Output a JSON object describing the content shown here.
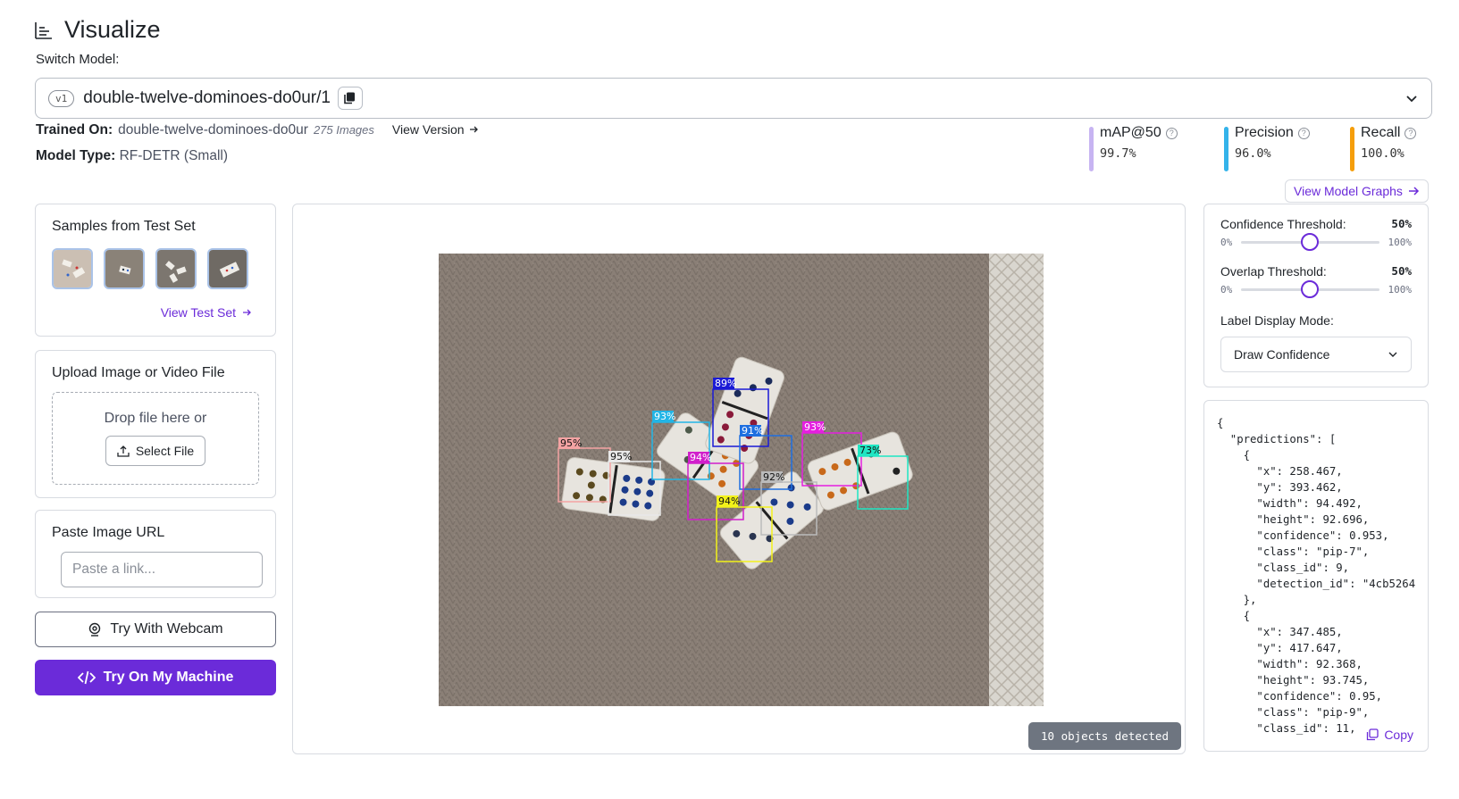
{
  "header": {
    "title": "Visualize",
    "switch_label": "Switch Model:"
  },
  "model": {
    "version": "v1",
    "name": "double-twelve-dominoes-do0ur/1"
  },
  "trained_on": {
    "label": "Trained On:",
    "value": "double-twelve-dominoes-do0ur",
    "images": "275 Images",
    "view_version": "View Version"
  },
  "model_type": {
    "label": "Model Type:",
    "value": "RF-DETR (Small)"
  },
  "metrics": [
    {
      "label": "mAP@50",
      "value": "99.7%",
      "color": "#c7b4f2"
    },
    {
      "label": "Precision",
      "value": "96.0%",
      "color": "#34b3ea"
    },
    {
      "label": "Recall",
      "value": "100.0%",
      "color": "#f59e0b"
    }
  ],
  "view_graphs": "View Model Graphs",
  "samples": {
    "title": "Samples from Test Set",
    "view_link": "View Test Set"
  },
  "upload": {
    "title": "Upload Image or Video File",
    "drop_text": "Drop file here or",
    "select_button": "Select File"
  },
  "paste": {
    "title": "Paste Image URL",
    "placeholder": "Paste a link..."
  },
  "buttons": {
    "webcam": "Try With Webcam",
    "machine": "Try On My Machine"
  },
  "viewer": {
    "objects_detected": "10 objects detected",
    "detections": [
      {
        "label": "95%",
        "color": "#f4a3a3"
      },
      {
        "label": "95%",
        "color": "#e8e8e8"
      },
      {
        "label": "93%",
        "color": "#22b5e6"
      },
      {
        "label": "89%",
        "color": "#1a1ad6"
      },
      {
        "label": "91%",
        "color": "#1e6fe0"
      },
      {
        "label": "94%",
        "color": "#d11fcb"
      },
      {
        "label": "92%",
        "color": "#bbbbbb"
      },
      {
        "label": "94%",
        "color": "#f2f21a"
      },
      {
        "label": "93%",
        "color": "#e51fe0"
      },
      {
        "label": "73%",
        "color": "#1fe6c3"
      }
    ]
  },
  "controls": {
    "confidence": {
      "label": "Confidence Threshold:",
      "value": "50%",
      "min": "0%",
      "max": "100%",
      "level": 0.5
    },
    "overlap": {
      "label": "Overlap Threshold:",
      "value": "50%",
      "min": "0%",
      "max": "100%",
      "level": 0.5
    },
    "mode": {
      "label": "Label Display Mode:",
      "value": "Draw Confidence"
    }
  },
  "json_output": {
    "text": "{\n  \"predictions\": [\n    {\n      \"x\": 258.467,\n      \"y\": 393.462,\n      \"width\": 94.492,\n      \"height\": 92.696,\n      \"confidence\": 0.953,\n      \"class\": \"pip-7\",\n      \"class_id\": 9,\n      \"detection_id\": \"4cb5264\n    },\n    {\n      \"x\": 347.485,\n      \"y\": 417.647,\n      \"width\": 92.368,\n      \"height\": 93.745,\n      \"confidence\": 0.95,\n      \"class\": \"pip-9\",\n      \"class_id\": 11,",
    "copy_label": "Copy"
  }
}
